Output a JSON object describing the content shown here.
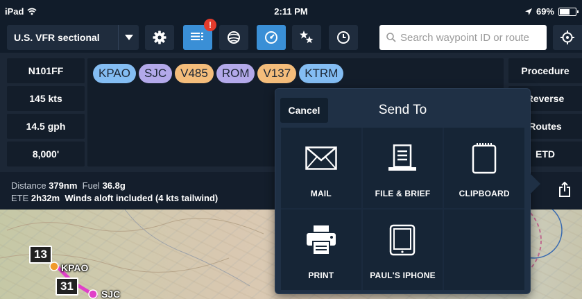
{
  "status_bar": {
    "device": "iPad",
    "time": "2:11 PM",
    "battery": "69%",
    "battery_fraction": 0.69
  },
  "toolbar": {
    "chart_selector": "U.S. VFR sectional",
    "badge": "!",
    "buttons": [
      "settings-icon",
      "flight-plan-icon",
      "layers-icon",
      "instruments-icon",
      "favorites-icon",
      "clock-icon"
    ],
    "search_placeholder": "Search waypoint ID or route"
  },
  "flight_plan": {
    "aircraft": "N101FF",
    "speed": "145 kts",
    "fuel_burn": "14.5 gph",
    "altitude": "8,000'",
    "route": [
      {
        "id": "KPAO",
        "kind": "airport"
      },
      {
        "id": "SJC",
        "kind": "vor"
      },
      {
        "id": "V485",
        "kind": "airway"
      },
      {
        "id": "ROM",
        "kind": "vor"
      },
      {
        "id": "V137",
        "kind": "airway"
      },
      {
        "id": "KTRM",
        "kind": "airport"
      }
    ],
    "right_buttons": [
      "Procedure",
      "Reverse",
      "Routes",
      "ETD"
    ]
  },
  "summary": {
    "distance_label": "Distance",
    "distance": "379nm",
    "fuel_label": "Fuel",
    "fuel": "36.8g",
    "ete_label": "ETE",
    "ete": "2h32m",
    "winds": "Winds aloft included (4 kts tailwind)"
  },
  "send_to": {
    "cancel": "Cancel",
    "title": "Send To",
    "options": [
      {
        "label": "MAIL",
        "icon": "mail-icon"
      },
      {
        "label": "FILE & BRIEF",
        "icon": "file-brief-icon"
      },
      {
        "label": "CLIPBOARD",
        "icon": "clipboard-icon"
      },
      {
        "label": "PRINT",
        "icon": "print-icon"
      },
      {
        "label": "PAUL'S IPHONE",
        "icon": "iphone-icon"
      }
    ]
  },
  "map": {
    "tag_top": "13",
    "tag_bottom": "31",
    "airport_1": "KPAO",
    "airport_2": "SJC"
  },
  "colors": {
    "accent": "#3a8fd6",
    "airport_chip": "#84bdf3",
    "vor_chip": "#b3a9ea",
    "airway_chip": "#f4bd7b",
    "route_line": "#e040c8"
  }
}
